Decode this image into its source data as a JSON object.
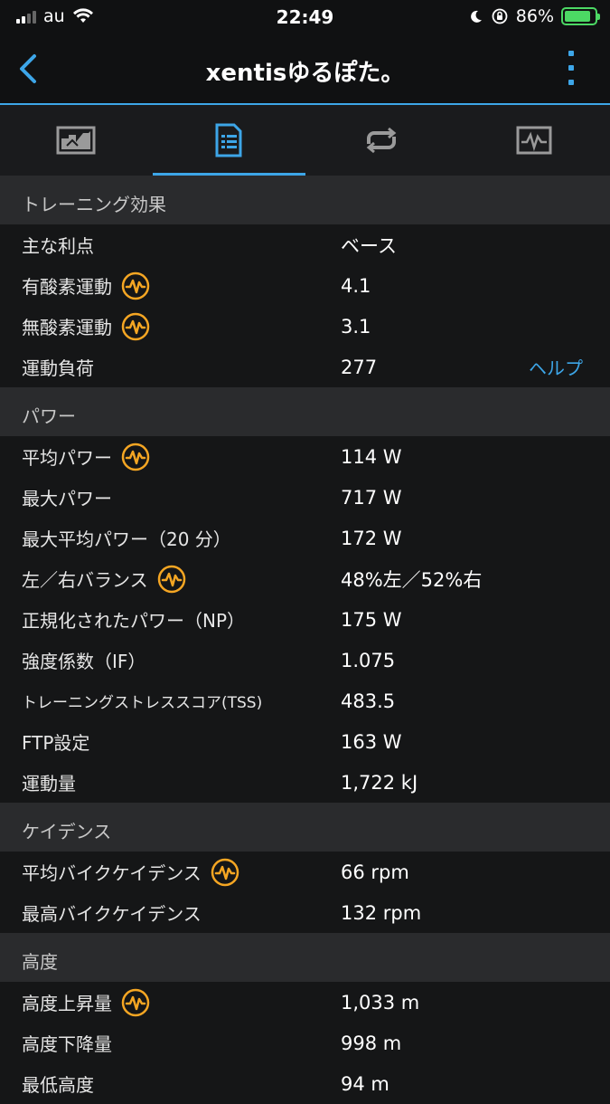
{
  "status": {
    "carrier": "au",
    "time": "22:49",
    "battery_percent": "86%"
  },
  "nav": {
    "title": "xentisゆるぽた。"
  },
  "tabs": [
    {
      "icon": "chart-icon",
      "active": false
    },
    {
      "icon": "details-list-icon",
      "active": true
    },
    {
      "icon": "laps-loop-icon",
      "active": false
    },
    {
      "icon": "graph-monitor-icon",
      "active": false
    }
  ],
  "sections": [
    {
      "title": "トレーニング効果",
      "rows": [
        {
          "label": "主な利点",
          "value": "ベース",
          "badge": false
        },
        {
          "label": "有酸素運動",
          "value": "4.1",
          "badge": true
        },
        {
          "label": "無酸素運動",
          "value": "3.1",
          "badge": true
        },
        {
          "label": "運動負荷",
          "value": "277",
          "badge": false,
          "link": "ヘルプ"
        }
      ]
    },
    {
      "title": "パワー",
      "rows": [
        {
          "label": "平均パワー",
          "value": "114 W",
          "badge": true
        },
        {
          "label": "最大パワー",
          "value": "717 W",
          "badge": false
        },
        {
          "label": "最大平均パワー（20 分）",
          "value": "172 W",
          "badge": false
        },
        {
          "label": "左／右バランス",
          "value": "48%左／52%右",
          "badge": true
        },
        {
          "label": "正規化されたパワー（NP）",
          "value": "175 W",
          "badge": false
        },
        {
          "label": "強度係数（IF）",
          "value": "1.075",
          "badge": false
        },
        {
          "label": "トレーニングストレススコア(TSS)",
          "value": "483.5",
          "badge": false
        },
        {
          "label": "FTP設定",
          "value": "163 W",
          "badge": false
        },
        {
          "label": "運動量",
          "value": "1,722 kJ",
          "badge": false
        }
      ]
    },
    {
      "title": "ケイデンス",
      "rows": [
        {
          "label": "平均バイクケイデンス",
          "value": "66 rpm",
          "badge": true
        },
        {
          "label": "最高バイクケイデンス",
          "value": "132 rpm",
          "badge": false
        }
      ]
    },
    {
      "title": "高度",
      "rows": [
        {
          "label": "高度上昇量",
          "value": "1,033 m",
          "badge": true
        },
        {
          "label": "高度下降量",
          "value": "998 m",
          "badge": false
        },
        {
          "label": "最低高度",
          "value": "94 m",
          "badge": false
        }
      ]
    }
  ],
  "colors": {
    "accent": "#3da6e8",
    "badge": "#f5a623",
    "battery": "#4cd964"
  }
}
